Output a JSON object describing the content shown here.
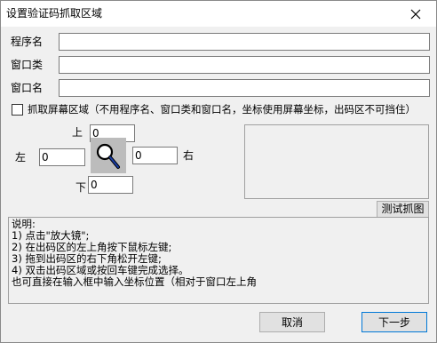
{
  "window": {
    "title": "设置验证码抓取区域",
    "close_glyph": "✕"
  },
  "form": {
    "program_name_label": "程序名",
    "program_name_value": "",
    "window_class_label": "窗口类",
    "window_class_value": "",
    "window_name_label": "窗口名",
    "window_name_value": ""
  },
  "capture": {
    "checkbox_label": "抓取屏幕区域（不用程序名、窗口类和窗口名，坐标使用屏幕坐标，出码区不可挡住）",
    "checked": false
  },
  "coords": {
    "top_label": "上",
    "top_value": "0",
    "left_label": "左",
    "left_value": "0",
    "right_label": "右",
    "right_value": "0",
    "bottom_label": "下",
    "bottom_value": "0"
  },
  "buttons": {
    "test_capture": "测试抓图",
    "cancel": "取消",
    "next": "下一步"
  },
  "help": {
    "lines": [
      "说明:",
      "1) 点击\"放大镜\";",
      "2) 在出码区的左上角按下鼠标左键;",
      "3) 拖到出码区的右下角松开左键;",
      "4) 双击出码区域或按回车键完成选择。",
      "也可直接在输入框中输入坐标位置（相对于窗口左上角"
    ]
  },
  "icons": {
    "magnifier": "magnifier-icon",
    "close": "close-icon"
  }
}
